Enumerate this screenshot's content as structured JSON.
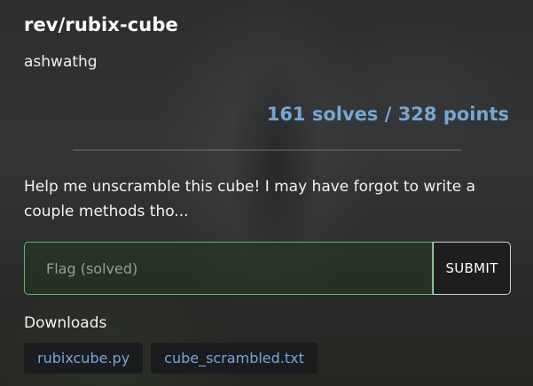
{
  "challenge": {
    "title": "rev/rubix-cube",
    "author": "ashwathg",
    "score": "161 solves / 328 points",
    "description": "Help me unscramble this cube! I may have forgot to write a couple methods tho..."
  },
  "flag_form": {
    "placeholder": "Flag (solved)",
    "value": "",
    "submit_label": "SUBMIT"
  },
  "downloads": {
    "label": "Downloads",
    "files": [
      {
        "name": "rubixcube.py"
      },
      {
        "name": "cube_scrambled.txt"
      }
    ]
  },
  "colors": {
    "accent": "#76a6d6",
    "input_border": "#4cc36a"
  }
}
